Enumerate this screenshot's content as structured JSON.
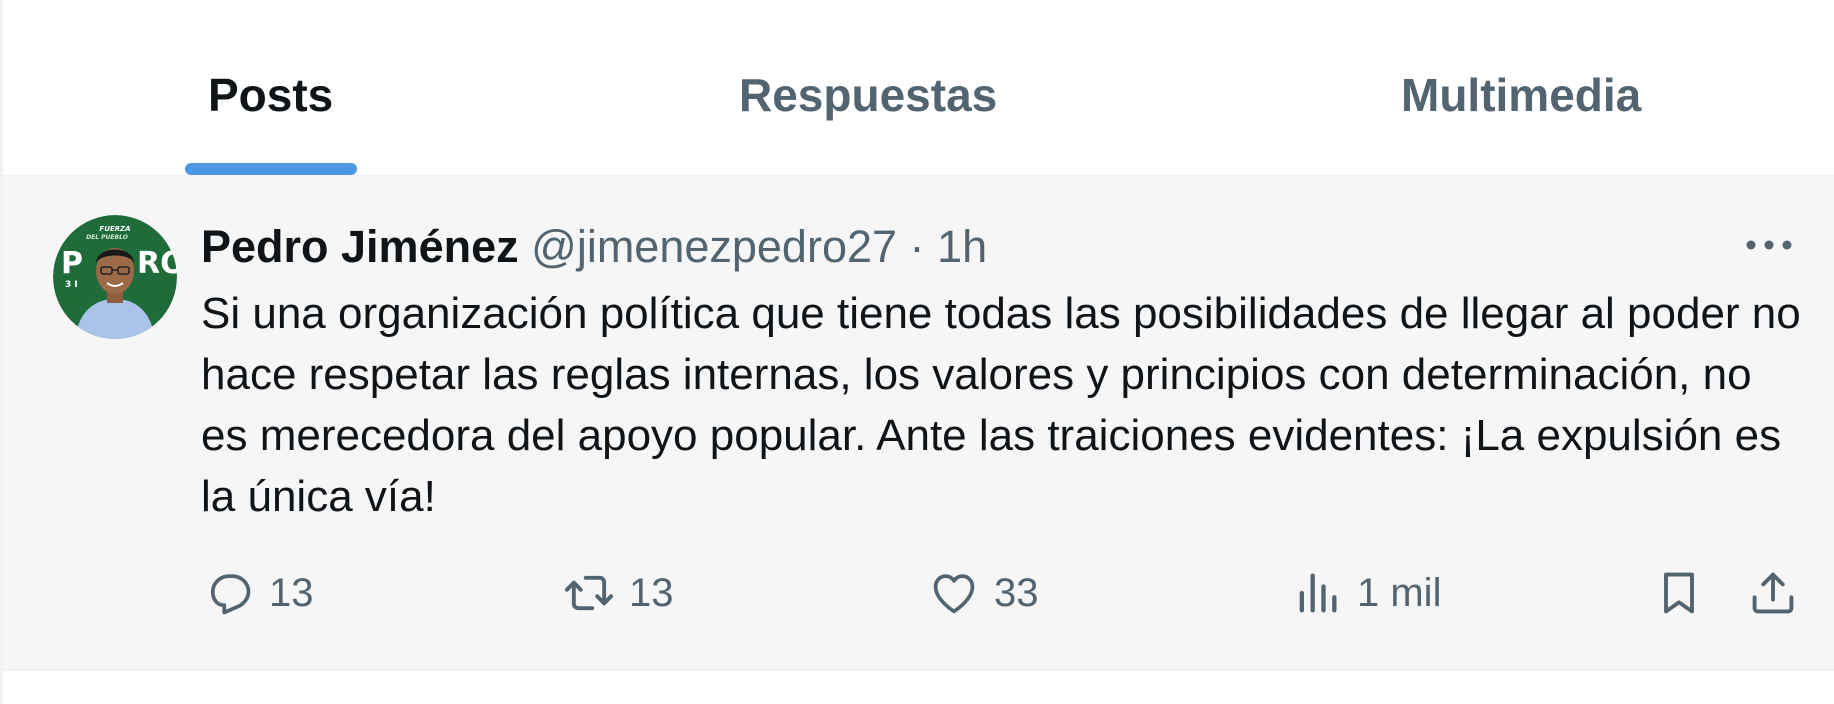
{
  "tabs": [
    {
      "label": "Posts",
      "active": true
    },
    {
      "label": "Respuestas",
      "active": false
    },
    {
      "label": "Multimedia",
      "active": false
    }
  ],
  "colors": {
    "accent": "#4c98e5",
    "secondary_text": "#536471",
    "primary_text": "#0f1419",
    "avatar_bg": "#1f6b3a"
  },
  "post": {
    "author_name": "Pedro Jiménez",
    "handle": "@jimenezpedro27",
    "separator": "·",
    "time": "1h",
    "text": "Si una organización política que tiene todas las posibilidades de llegar al poder no hace respetar las reglas internas, los valores y principios con determinación, no es merecedora del apoyo popular. Ante las traiciones evidentes: ¡La expulsión es la única vía!",
    "avatar_badge_text": "FUERZA DEL PUEBLO",
    "actions": {
      "replies": "13",
      "reposts": "13",
      "likes": "33",
      "views": "1 mil"
    },
    "icons": [
      "reply-icon",
      "repost-icon",
      "like-icon",
      "views-icon",
      "bookmark-icon",
      "share-icon",
      "more-icon"
    ]
  }
}
